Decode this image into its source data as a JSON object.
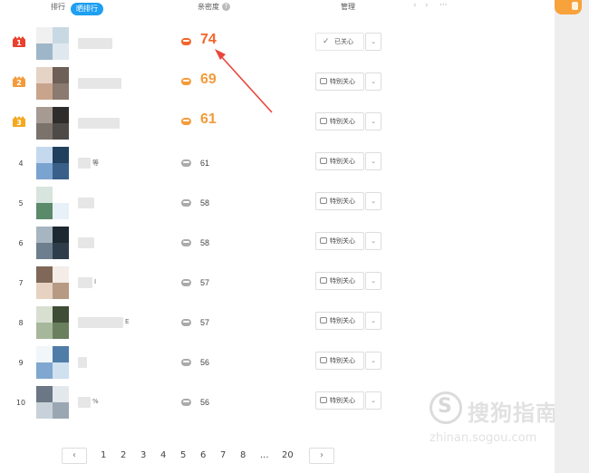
{
  "header": {
    "tab_rank": "排行",
    "tab_pill": "晒排行",
    "col_intimacy": "亲密度",
    "col_manage": "管理",
    "help": "?",
    "nav_left": "‹",
    "nav_right": "›",
    "nav_more": "···"
  },
  "colors": {
    "accent": "#1e9ff2",
    "rank1": "#e8412e",
    "rank2": "#f39b3b",
    "rank3": "#f4a81e",
    "score_hot": "#f3652b",
    "score_warm": "#f39b3b",
    "heart_grey": "#aaaaaa"
  },
  "rows": [
    {
      "rank": "1",
      "score": "74",
      "button": "已关心",
      "followed": true,
      "name_suffix": ""
    },
    {
      "rank": "2",
      "score": "69",
      "button": "特别关心",
      "followed": false,
      "name_suffix": ""
    },
    {
      "rank": "3",
      "score": "61",
      "button": "特别关心",
      "followed": false,
      "name_suffix": ""
    },
    {
      "rank": "4",
      "score": "61",
      "button": "特别关心",
      "followed": false,
      "name_suffix": "等"
    },
    {
      "rank": "5",
      "score": "58",
      "button": "特别关心",
      "followed": false,
      "name_suffix": ""
    },
    {
      "rank": "6",
      "score": "58",
      "button": "特别关心",
      "followed": false,
      "name_suffix": ""
    },
    {
      "rank": "7",
      "score": "57",
      "button": "特别关心",
      "followed": false,
      "name_suffix": "I"
    },
    {
      "rank": "8",
      "score": "57",
      "button": "特别关心",
      "followed": false,
      "name_suffix": "E"
    },
    {
      "rank": "9",
      "score": "56",
      "button": "特别关心",
      "followed": false,
      "name_suffix": ""
    },
    {
      "rank": "10",
      "score": "56",
      "button": "特别关心",
      "followed": false,
      "name_suffix": "%"
    }
  ],
  "dropdown": "⌄",
  "pager": {
    "prev": "‹",
    "next": "›",
    "pages": [
      "1",
      "2",
      "3",
      "4",
      "5",
      "6",
      "7",
      "8",
      "...",
      "20"
    ]
  },
  "watermark": {
    "logo_letter": "S",
    "text": "搜狗指南",
    "url": "zhinan.sogou.com"
  }
}
